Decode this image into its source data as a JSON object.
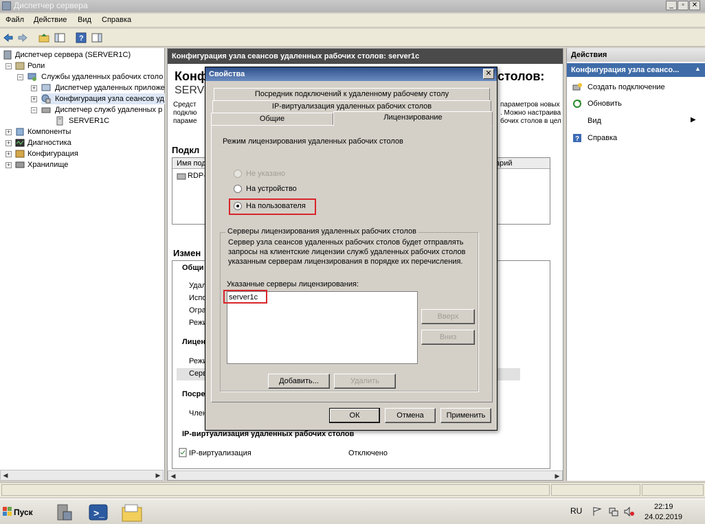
{
  "window": {
    "title": "Диспетчер сервера"
  },
  "menu": [
    "Файл",
    "Действие",
    "Вид",
    "Справка"
  ],
  "tree": {
    "root": "Диспетчер сервера (SERVER1C)",
    "roles": "Роли",
    "rds": "Службы удаленных рабочих столо",
    "remote_app": "Диспетчер удаленных приложе",
    "rdsh_config": "Конфигурация узла сеансов уд",
    "lic_manager": "Диспетчер служб удаленных р",
    "server": "SERVER1C",
    "components": "Компоненты",
    "diagnostics": "Диагностика",
    "configuration": "Конфигурация",
    "storage": "Хранилище"
  },
  "center": {
    "header": "Конфигурация узла сеансов удаленных рабочих столов: server1c",
    "big_title": "Конф",
    "big_title_right": "столов:",
    "big_subtitle": "SERV",
    "desc_left": [
      "Средст",
      "подклю",
      "параме"
    ],
    "desc_right": [
      "параметров новых",
      ". Можно настраива",
      "бочих столов в цел"
    ],
    "connections_title": "Подкл",
    "conn_col_name": "Имя под",
    "conn_col_comment": "арий",
    "conn_row": "RDP-",
    "changes_title": "Измен",
    "section_general": "Общи",
    "general_items": [
      "Удал",
      "Испо",
      "Огра",
      "Режи"
    ],
    "section_licensing": "Лицен",
    "licensing_items": [
      "Режи",
      "Серв"
    ],
    "section_broker": "Посре",
    "broker_items": [
      "Член"
    ],
    "section_ipv": "IP-виртуализация удаленных рабочих столов",
    "ipv_item_label": "IP-виртуализация",
    "ipv_item_value": "Отключено"
  },
  "actions": {
    "header": "Действия",
    "subheader": "Конфигурация узла сеансо...",
    "items": [
      "Создать подключение",
      "Обновить",
      "Вид",
      "Справка"
    ]
  },
  "dialog": {
    "title": "Свойства",
    "tabs_row1": [
      "Посредник подключений к удаленному рабочему столу"
    ],
    "tabs_row2": [
      "IP-виртуализация удаленных рабочих столов"
    ],
    "tabs_row3": [
      "Общие",
      "Лицензирование"
    ],
    "mode_label": "Режим лицензирования удаленных рабочих столов",
    "radio_options": [
      "Не указано",
      "На устройство",
      "На пользователя"
    ],
    "selected_option": "На пользователя",
    "group_title": "Серверы лицензирования удаленных рабочих столов",
    "group_desc": [
      "Сервер узла сеансов удаленных рабочих столов будет отправлять",
      "запросы на клиентские лицензии служб удаленных рабочих столов",
      "указанным серверам лицензирования в порядке их перечисления."
    ],
    "servers_label": "Указанные серверы лицензирования:",
    "servers": [
      "server1c"
    ],
    "btn_up": "Вверх",
    "btn_down": "Вниз",
    "btn_add": "Добавить...",
    "btn_remove": "Удалить",
    "btn_ok": "ОК",
    "btn_cancel": "Отмена",
    "btn_apply": "Применить"
  },
  "taskbar": {
    "start": "Пуск",
    "lang": "RU",
    "time": "22:19",
    "date": "24.02.2019"
  },
  "colors": {
    "highlight": "#d8252a",
    "dialog_title": "#2e4f8a",
    "actions_sub": "#3f6ca8"
  }
}
